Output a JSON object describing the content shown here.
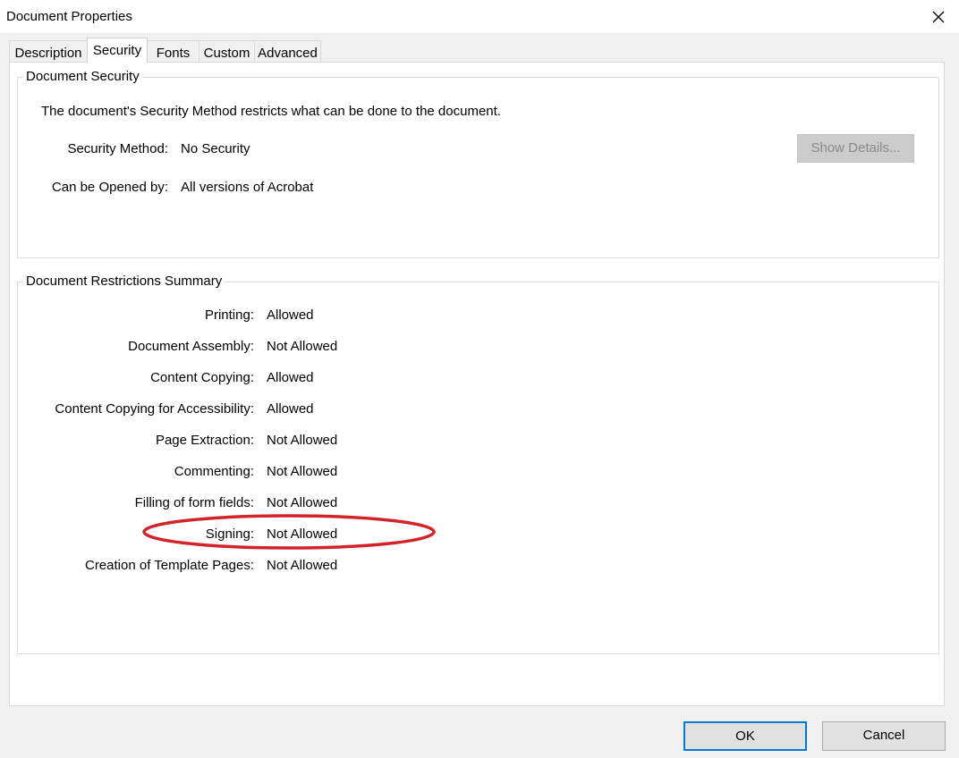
{
  "window": {
    "title": "Document Properties",
    "close_icon": "close-icon"
  },
  "tabs": [
    {
      "label": "Description",
      "active": false
    },
    {
      "label": "Security",
      "active": true
    },
    {
      "label": "Fonts",
      "active": false
    },
    {
      "label": "Custom",
      "active": false
    },
    {
      "label": "Advanced",
      "active": false
    }
  ],
  "security": {
    "legend": "Document Security",
    "description": "The document's Security Method restricts what can be done to the document.",
    "method_label": "Security Method:",
    "method_value": "No Security",
    "opened_label": "Can be Opened by:",
    "opened_value": "All versions of Acrobat",
    "show_details": "Show Details..."
  },
  "restrictions": {
    "legend": "Document Restrictions Summary",
    "rows": [
      {
        "label": "Printing:",
        "value": "Allowed"
      },
      {
        "label": "Document Assembly:",
        "value": "Not Allowed"
      },
      {
        "label": "Content Copying:",
        "value": "Allowed"
      },
      {
        "label": "Content Copying for Accessibility:",
        "value": "Allowed"
      },
      {
        "label": "Page Extraction:",
        "value": "Not Allowed"
      },
      {
        "label": "Commenting:",
        "value": "Not Allowed"
      },
      {
        "label": "Filling of form fields:",
        "value": "Not Allowed"
      },
      {
        "label": "Signing:",
        "value": "Not Allowed"
      },
      {
        "label": "Creation of Template Pages:",
        "value": "Not Allowed"
      }
    ]
  },
  "buttons": {
    "ok": "OK",
    "cancel": "Cancel"
  },
  "colors": {
    "annotation_red": "#d2232a",
    "default_button_border": "#0078d7"
  }
}
